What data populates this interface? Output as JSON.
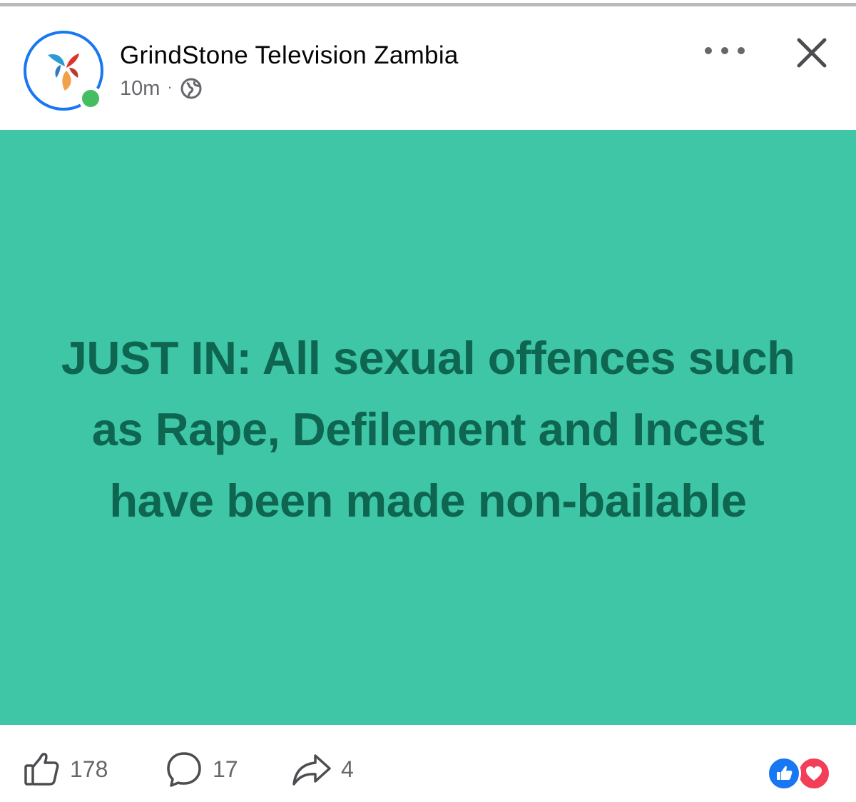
{
  "post": {
    "author": "GrindStone Television Zambia",
    "time": "10m",
    "separator": "·",
    "audience_icon": "globe-icon",
    "text": "JUST IN: All sexual offences such as Rape, Defilement and Incest have been made non-bailable",
    "background_color": "#3ec6a6",
    "text_color": "#0e6650"
  },
  "header": {
    "more_icon": "ellipsis-icon",
    "close_icon": "close-icon",
    "online": true
  },
  "footer": {
    "likes": "178",
    "comments": "17",
    "shares": "4",
    "like_icon": "thumbs-up-icon",
    "comment_icon": "comment-bubble-icon",
    "share_icon": "share-arrow-icon",
    "reactions": [
      "like",
      "love"
    ]
  },
  "colors": {
    "brand_blue": "#1877f2",
    "online_green": "#45bd62",
    "love_red": "#f33e58",
    "secondary_text": "#65676b"
  }
}
